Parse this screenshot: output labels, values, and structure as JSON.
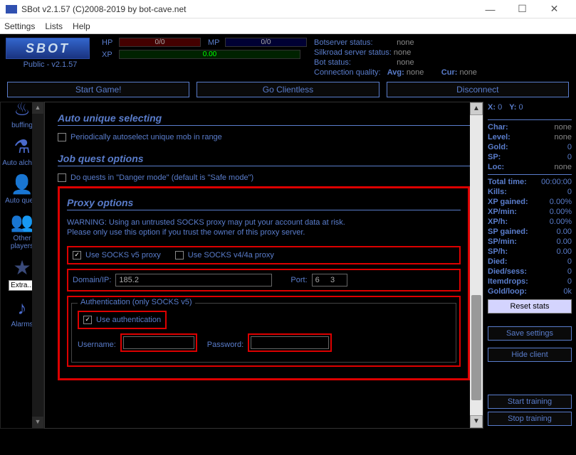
{
  "window": {
    "title": "SBot v2.1.57 (C)2008-2019 by bot-cave.net"
  },
  "menu": {
    "settings": "Settings",
    "lists": "Lists",
    "help": "Help"
  },
  "logo": {
    "text": "SBOT",
    "version": "Public - v2.1.57"
  },
  "bars": {
    "hp_label": "HP",
    "hp_text": "0/0",
    "mp_label": "MP",
    "mp_text": "0/0",
    "xp_label": "XP",
    "xp_text": "0.00"
  },
  "status": {
    "botserver_k": "Botserver status:",
    "botserver_v": "none",
    "silkroad_k": "Silkroad server status:",
    "silkroad_v": "none",
    "bot_k": "Bot status:",
    "bot_v": "none",
    "conn_k": "Connection quality:",
    "avg_k": "Avg:",
    "avg_v": "none",
    "cur_k": "Cur:",
    "cur_v": "none"
  },
  "buttons": {
    "start": "Start Game!",
    "clientless": "Go Clientless",
    "disconnect": "Disconnect"
  },
  "sidebar": {
    "buffing": "buffing",
    "alchemy": "Auto alche...",
    "quest": "Auto quest",
    "players": "Other players",
    "extra": "Extra...",
    "alarms": "Alarms"
  },
  "content": {
    "unique_title": "Auto unique selecting",
    "unique_chk": "Periodically autoselect unique mob in range",
    "job_title": "Job quest options",
    "job_chk": "Do quests in \"Danger mode\" (default is \"Safe mode\")",
    "proxy_title": "Proxy options",
    "proxy_warn1": "WARNING: Using an untrusted SOCKS proxy may put your account data at risk.",
    "proxy_warn2": "Please only use this option if you trust the owner of this proxy server.",
    "use_v5": "Use SOCKS v5 proxy",
    "use_v4": "Use SOCKS v4/4a proxy",
    "domain_label": "Domain/IP:",
    "domain_value": "185.2",
    "port_label": "Port:",
    "port_value": "6     3",
    "auth_legend": "Authentication (only SOCKS v5)",
    "use_auth": "Use authentication",
    "user_label": "Username:",
    "user_value": "",
    "pass_label": "Password:",
    "pass_value": ""
  },
  "right": {
    "x_k": "X:",
    "x_v": "0",
    "y_k": "Y:",
    "y_v": "0",
    "char_k": "Char:",
    "char_v": "none",
    "level_k": "Level:",
    "level_v": "none",
    "gold_k": "Gold:",
    "gold_v": "0",
    "sp_k": "SP:",
    "sp_v": "0",
    "loc_k": "Loc:",
    "loc_v": "none",
    "total_k": "Total time:",
    "total_v": "00:00:00",
    "kills_k": "Kills:",
    "kills_v": "0",
    "xpg_k": "XP gained:",
    "xpg_v": "0.00%",
    "xpm_k": "XP/min:",
    "xpm_v": "0.00%",
    "xph_k": "XP/h:",
    "xph_v": "0.00%",
    "spg_k": "SP gained:",
    "spg_v": "0.00",
    "spm_k": "SP/min:",
    "spm_v": "0.00",
    "sph_k": "SP/h:",
    "sph_v": "0.00",
    "died_k": "Died:",
    "died_v": "0",
    "dieds_k": "Died/sess:",
    "dieds_v": "0",
    "drops_k": "Itemdrops:",
    "drops_v": "0",
    "loop_k": "Gold/loop:",
    "loop_v": "0k",
    "reset": "Reset stats",
    "save": "Save settings",
    "hide": "Hide client",
    "start_tr": "Start training",
    "stop_tr": "Stop training"
  }
}
